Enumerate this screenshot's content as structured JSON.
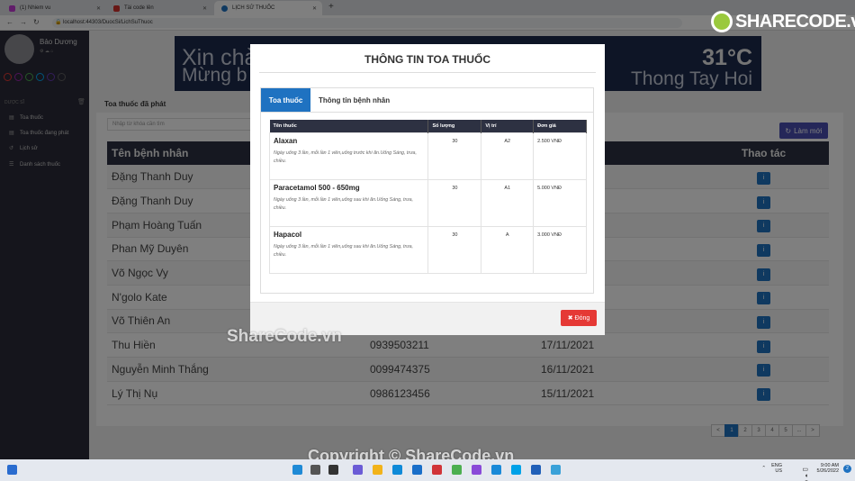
{
  "browser": {
    "tabs": [
      {
        "title": "(1) Nhiem vu",
        "fav_color": "#c23bd4"
      },
      {
        "title": "Tài code lên",
        "fav_color": "#d0312d"
      },
      {
        "title": "LỊCH SỬ THUỐC",
        "fav_color": "#1f72c1"
      }
    ],
    "url": "localhost:44303/DuocSi/LichSuThuoc"
  },
  "sidebar": {
    "user_name": "Bảo Dương",
    "section": "DƯỢC SĨ",
    "items": [
      {
        "label": "Toa thuốc",
        "icon": "file-icon"
      },
      {
        "label": "Toa thuốc đang phát",
        "icon": "file-icon"
      },
      {
        "label": "Lịch sử",
        "icon": "history-icon"
      },
      {
        "label": "Danh sách thuốc",
        "icon": "list-icon"
      }
    ],
    "dot_colors": [
      "#e53935",
      "#9c27b0",
      "#4caf50",
      "#03a9f4",
      "#673ab7",
      "#616161"
    ]
  },
  "banner": {
    "greeting": "Xin chào",
    "subgreeting": "Mừng b",
    "temperature": "31°C",
    "place": "Thong Tay Hoi"
  },
  "page": {
    "panel_title": "Toa thuốc đã phát",
    "search_placeholder": "Nhập từ khóa cần tìm",
    "refresh_label": "Làm mới",
    "columns": [
      "Tên bệnh nhân",
      "",
      "y Khám",
      "Thao tác"
    ],
    "rows": [
      {
        "name": "Đặng Thanh Duy",
        "phone": "",
        "date": "12/2021"
      },
      {
        "name": "Đặng Thanh Duy",
        "phone": "",
        "date": "12/2021"
      },
      {
        "name": "Phạm Hoàng Tuấn",
        "phone": "",
        "date": "12/2021"
      },
      {
        "name": "Phan Mỹ Duyên",
        "phone": "",
        "date": "11/2021"
      },
      {
        "name": "Võ Ngọc Vy",
        "phone": "",
        "date": "11/2021"
      },
      {
        "name": "N'golo Kate",
        "phone": "",
        "date": "11/2021"
      },
      {
        "name": "Võ Thiên An",
        "phone": "",
        "date": "11/2021"
      },
      {
        "name": "Thu Hiền",
        "phone": "0939503211",
        "date": "17/11/2021"
      },
      {
        "name": "Nguyễn Minh Thắng",
        "phone": "0099474375",
        "date": "16/11/2021"
      },
      {
        "name": "Lý Thị Nụ",
        "phone": "0986123456",
        "date": "15/11/2021"
      }
    ],
    "pagination": [
      "<",
      "1",
      "2",
      "3",
      "4",
      "5",
      "...",
      ">"
    ]
  },
  "modal": {
    "title": "THÔNG TIN TOA THUỐC",
    "tabs": [
      "Toa thuốc",
      "Thông tin bệnh nhân"
    ],
    "columns": [
      "Tên thuốc",
      "Số lượng",
      "Vị trí",
      "Đơn giá"
    ],
    "drugs": [
      {
        "name": "Alaxan",
        "usage": "Ngày uống 3 lần, mỗi lần 1 viên,uống trước khi ăn.Uống Sáng, trưa, chiều.",
        "qty": "30",
        "loc": "A2",
        "price": "2.500 VNĐ"
      },
      {
        "name": "Paracetamol 500 - 650mg",
        "usage": "Ngày uống 3 lần, mỗi lần 1 viên,uống sau khi ăn.Uống Sáng, trưa, chiều.",
        "qty": "30",
        "loc": "A1",
        "price": "5.000 VNĐ"
      },
      {
        "name": "Hapacol",
        "usage": "Ngày uống 3 lần, mỗi lần 1 viên,uống sau khi ăn.Uống Sáng, trưa, chiều.",
        "qty": "30",
        "loc": "A",
        "price": "3.000 VNĐ"
      }
    ],
    "close_label": "Đóng"
  },
  "watermarks": {
    "logo": "SHARECODE.vn",
    "center": "ShareCode.vn",
    "copyright": "Copyright © ShareCode.vn"
  },
  "taskbar": {
    "lang": "ENG",
    "region": "US",
    "time": "9:00 AM",
    "date": "5/26/2022",
    "badge": "2"
  }
}
